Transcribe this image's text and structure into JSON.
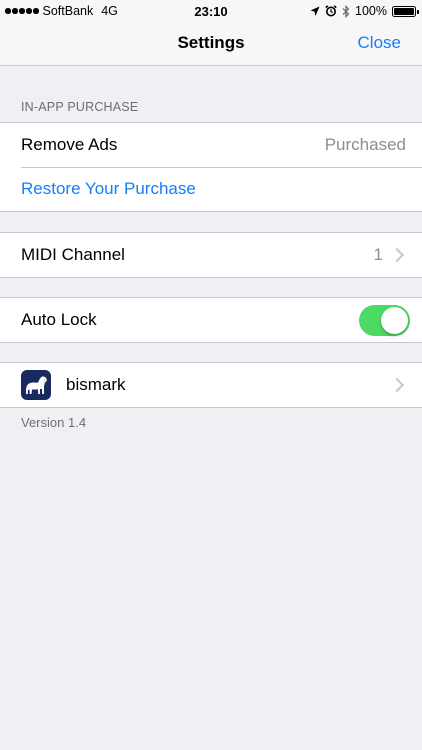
{
  "status_bar": {
    "carrier": "SoftBank",
    "network": "4G",
    "time": "23:10",
    "battery": "100%",
    "icons": [
      "location-icon",
      "alarm-icon",
      "bluetooth-icon",
      "battery-icon"
    ]
  },
  "nav": {
    "title": "Settings",
    "close_label": "Close"
  },
  "sections": {
    "purchase": {
      "header": "IN-APP PURCHASE",
      "remove_ads_label": "Remove Ads",
      "remove_ads_value": "Purchased",
      "restore_label": "Restore Your Purchase"
    },
    "midi": {
      "label": "MIDI Channel",
      "value": "1"
    },
    "lock": {
      "label": "Auto Lock",
      "enabled": true
    },
    "app": {
      "label": "bismark",
      "icon": "dog-icon"
    }
  },
  "footer": {
    "version": "Version 1.4"
  },
  "colors": {
    "accent": "#157efb",
    "toggle_on": "#4cd964",
    "background": "#efeff4",
    "app_icon_bg": "#1b2a5e"
  }
}
